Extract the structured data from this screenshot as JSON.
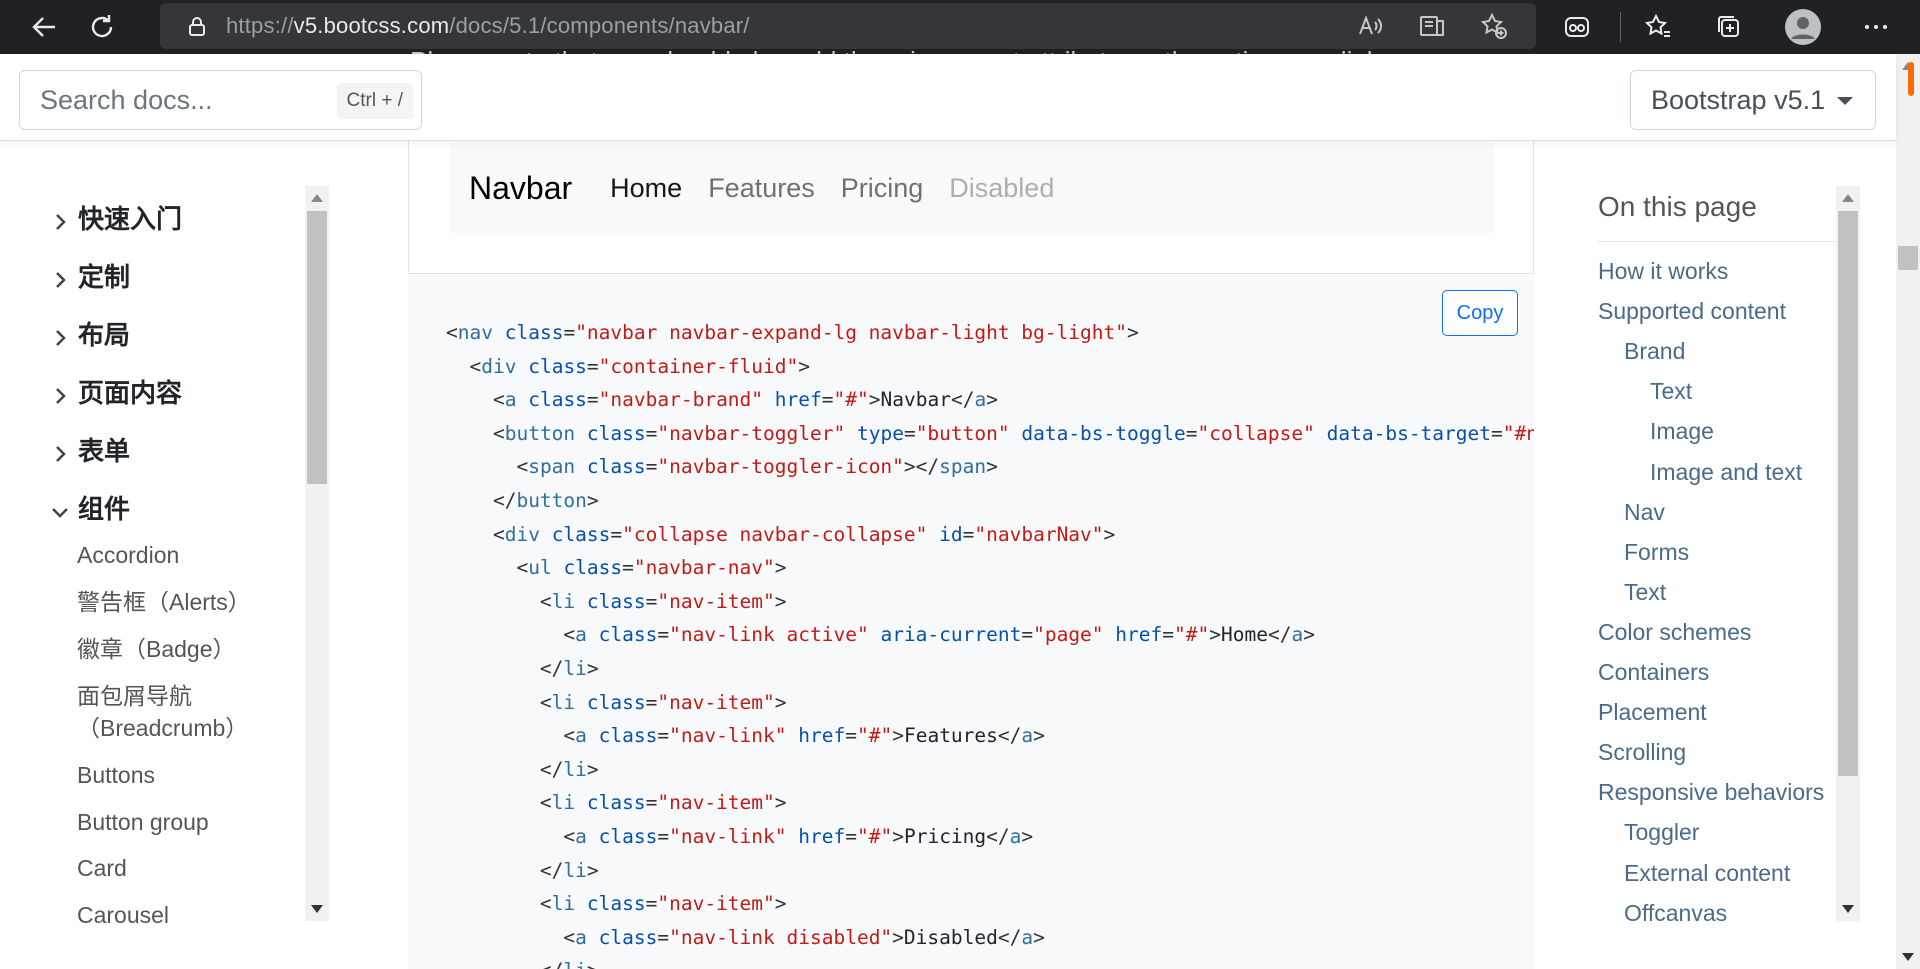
{
  "browser": {
    "url_prefix": "https://",
    "url_host": "v5.bootcss.com",
    "url_path": "/docs/5.1/components/navbar/"
  },
  "topbar": {
    "search_placeholder": "Search docs...",
    "search_shortcut": "Ctrl + /",
    "version_label": "Bootstrap v5.1",
    "ghost_text": "Please note that you should also add the aria-current attribute on the active .nav-link."
  },
  "sidebar": {
    "sections": [
      {
        "label": "快速入门",
        "expanded": false
      },
      {
        "label": "定制",
        "expanded": false
      },
      {
        "label": "布局",
        "expanded": false
      },
      {
        "label": "页面内容",
        "expanded": false
      },
      {
        "label": "表单",
        "expanded": false
      },
      {
        "label": "组件",
        "expanded": true
      }
    ],
    "items": [
      "Accordion",
      "警告框（Alerts）",
      "徽章（Badge）",
      "面包屑导航",
      "（Breadcrumb）",
      "Buttons",
      "Button group",
      "Card",
      "Carousel"
    ]
  },
  "example": {
    "brand": "Navbar",
    "links": [
      {
        "label": "Home",
        "state": "active"
      },
      {
        "label": "Features",
        "state": "normal"
      },
      {
        "label": "Pricing",
        "state": "normal"
      },
      {
        "label": "Disabled",
        "state": "disabled"
      }
    ],
    "copy_label": "Copy"
  },
  "code_lines": [
    "<nav class=\"navbar navbar-expand-lg navbar-light bg-light\">",
    "  <div class=\"container-fluid\">",
    "    <a class=\"navbar-brand\" href=\"#\">Navbar</a>",
    "    <button class=\"navbar-toggler\" type=\"button\" data-bs-toggle=\"collapse\" data-bs-target=\"#navbarNav\" aria-controls=\"navbarNav\"",
    "      <span class=\"navbar-toggler-icon\"></span>",
    "    </button>",
    "    <div class=\"collapse navbar-collapse\" id=\"navbarNav\">",
    "      <ul class=\"navbar-nav\">",
    "        <li class=\"nav-item\">",
    "          <a class=\"nav-link active\" aria-current=\"page\" href=\"#\">Home</a>",
    "        </li>",
    "        <li class=\"nav-item\">",
    "          <a class=\"nav-link\" href=\"#\">Features</a>",
    "        </li>",
    "        <li class=\"nav-item\">",
    "          <a class=\"nav-link\" href=\"#\">Pricing</a>",
    "        </li>",
    "        <li class=\"nav-item\">",
    "          <a class=\"nav-link disabled\">Disabled</a>",
    "        </li>"
  ],
  "toc": {
    "title": "On this page",
    "items": [
      {
        "label": "How it works",
        "level": 0
      },
      {
        "label": "Supported content",
        "level": 0
      },
      {
        "label": "Brand",
        "level": 1
      },
      {
        "label": "Text",
        "level": 2
      },
      {
        "label": "Image",
        "level": 2
      },
      {
        "label": "Image and text",
        "level": 2
      },
      {
        "label": "Nav",
        "level": 1
      },
      {
        "label": "Forms",
        "level": 1
      },
      {
        "label": "Text",
        "level": 1
      },
      {
        "label": "Color schemes",
        "level": 0
      },
      {
        "label": "Containers",
        "level": 0
      },
      {
        "label": "Placement",
        "level": 0
      },
      {
        "label": "Scrolling",
        "level": 0
      },
      {
        "label": "Responsive behaviors",
        "level": 0
      },
      {
        "label": "Toggler",
        "level": 1
      },
      {
        "label": "External content",
        "level": 1
      },
      {
        "label": "Offcanvas",
        "level": 1
      }
    ]
  }
}
